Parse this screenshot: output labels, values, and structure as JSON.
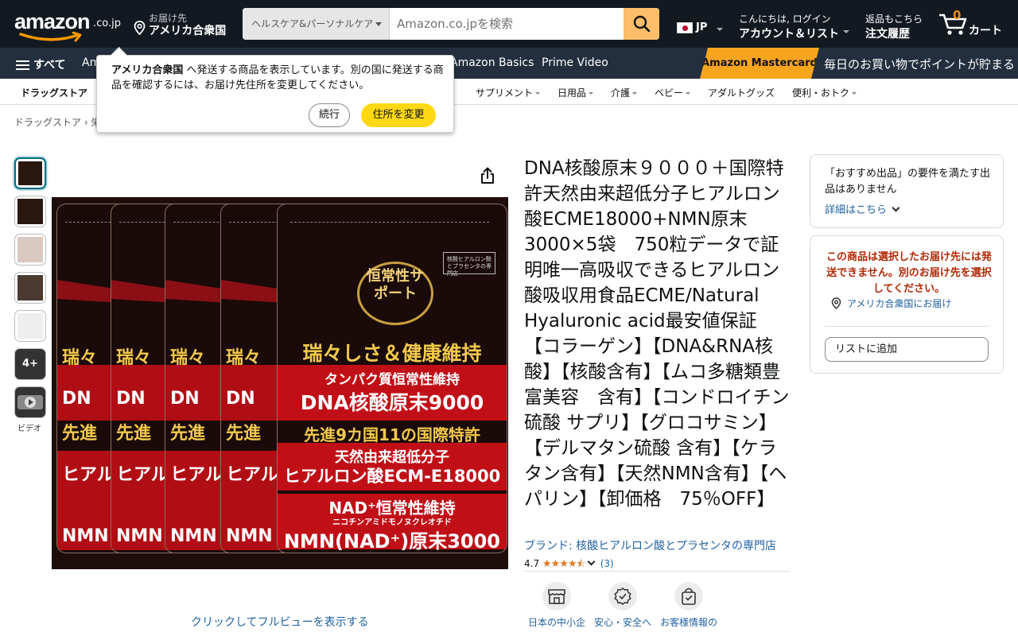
{
  "header": {
    "logo_text": "amazon",
    "logo_tld": ".co.jp",
    "deliver_line1": "お届け先",
    "deliver_line2": "アメリカ合衆国",
    "search_category": "ヘルスケア&パーソナルケア",
    "search_placeholder": "Amazon.co.jpを検索",
    "lang": "JP",
    "account_line1": "こんにちは, ログイン",
    "account_line2": "アカウント＆リスト",
    "orders_line1": "返品もこちら",
    "orders_line2": "注文履歴",
    "cart_count": "0",
    "cart_label": "カート",
    "accent_color": "#febd69",
    "bar_color": "#131921"
  },
  "nav": {
    "all_label": "すべて",
    "items": [
      "Am",
      "Amazon Basics",
      "Prime Video"
    ],
    "promo_tag": "Amazon Mastercard",
    "promo_text": "毎日のお買い物でポイントが貯まる"
  },
  "subnav": {
    "items": [
      "ドラッグストア",
      "サプリメント",
      "日用品",
      "介護",
      "ベビー",
      "アダルトグッズ",
      "便利・おトク"
    ]
  },
  "breadcrumb": {
    "text": "ドラッグストア › 栄"
  },
  "popup": {
    "bold": "アメリカ合衆国",
    "message": " へ発送する商品を表示しています。別の国に発送する商品を確認するには、お届け先住所を変更してください。",
    "continue": "続行",
    "change": "住所を変更"
  },
  "gallery": {
    "more_label": "4+",
    "video_label": "ビデオ",
    "fullview": "クリックしてフルビューを表示する"
  },
  "image_text": {
    "seal": "恒常性サポート",
    "badge": "核酸ヒアルロン酸とプラセンタの専門店",
    "line1": "瑞々しさ＆健康維持",
    "line2": "タンパク質恒常性維持",
    "line3": "DNA核酸原末9000",
    "line4": "先進9カ国11の国際特許",
    "line5": "天然由来超低分子",
    "line6": "ヒアルロン酸ECM-E18000",
    "line7": "NAD⁺恒常性維持",
    "line8": "ニコチンアミドモノヌクレオチド",
    "line9": "NMN(NAD⁺)原末3000",
    "side1": "瑞々",
    "side2": "DN",
    "side3": "先進",
    "side4": "ヒアル",
    "side5": "NMN"
  },
  "product": {
    "title": "DNA核酸原末９０００＋国際特許天然由来超低分子ヒアルロン酸ECME18000+NMN原末3000×5袋　750粒データで証明唯一高吸収できるヒアルロン酸吸収用食品ECME/Natural Hyaluronic acid最安値保証【コラーゲン】【DNA&RNA核酸】【核酸含有】【ムコ多糖類豊富美容　含有】【コンドロイチン硫酸 サプリ】【グロコサミン】【デルマタン硫酸 含有】【ケラタン含有】【天然NMN含有】【ヘパリン】【卸価格　75％OFF】",
    "brand": "ブランド: 核酸ヒアルロン酸とプラセンタの専門店",
    "rating": "4.7",
    "stars": "★★★★⯪",
    "review_count": "(3)",
    "features": [
      "日本の中小企",
      "安心・安全へ",
      "お客様情報の"
    ]
  },
  "buybox": {
    "no_offer": "「おすすめ出品」の要件を満たす出品はありません",
    "details": "詳細はこちら",
    "warning": "この商品は選択したお届け先には発送できません。別のお届け先を選択してください。",
    "location": "アメリカ合衆国にお届け",
    "add_to_list": "リストに追加"
  }
}
